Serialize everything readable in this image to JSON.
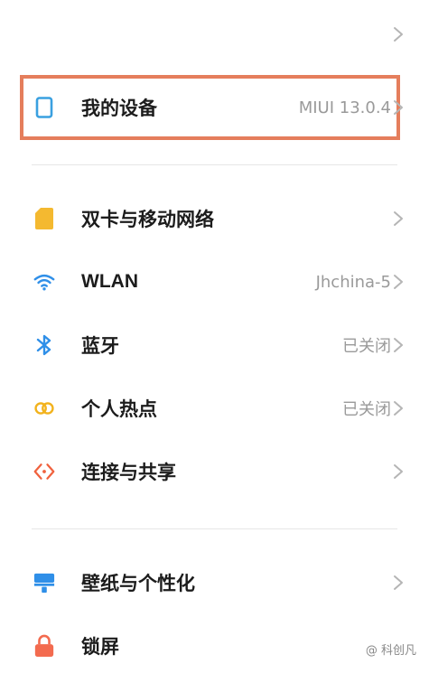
{
  "rows": {
    "my_device": {
      "label": "我的设备",
      "value": "MIUI 13.0.4"
    },
    "dual_sim": {
      "label": "双卡与移动网络",
      "value": ""
    },
    "wlan": {
      "label": "WLAN",
      "value": "Jhchina-5"
    },
    "bluetooth": {
      "label": "蓝牙",
      "value": "已关闭"
    },
    "hotspot": {
      "label": "个人热点",
      "value": "已关闭"
    },
    "connect_share": {
      "label": "连接与共享",
      "value": ""
    },
    "wallpaper": {
      "label": "壁纸与个性化",
      "value": ""
    },
    "lock_screen": {
      "label": "锁屏",
      "value": ""
    }
  },
  "watermark": "@ 科创凡",
  "colors": {
    "highlight": "#e57e5c",
    "device_icon": "#3aa0e0",
    "sim_icon": "#f4b930",
    "wlan_icon": "#2f8fe8",
    "bluetooth_icon": "#2f8fe8",
    "hotspot_icon": "#f2b21c",
    "share_icon": "#f0613d",
    "wallpaper_icon": "#2f8fe8",
    "lock_icon": "#f36b4f"
  },
  "icons": {
    "top": "chevron-right-icon",
    "my_device": "device-icon",
    "dual_sim": "sim-card-icon",
    "wlan": "wifi-icon",
    "bluetooth": "bluetooth-icon",
    "hotspot": "hotspot-icon",
    "connect_share": "share-icon",
    "wallpaper": "wallpaper-icon",
    "lock_screen": "lock-icon"
  }
}
